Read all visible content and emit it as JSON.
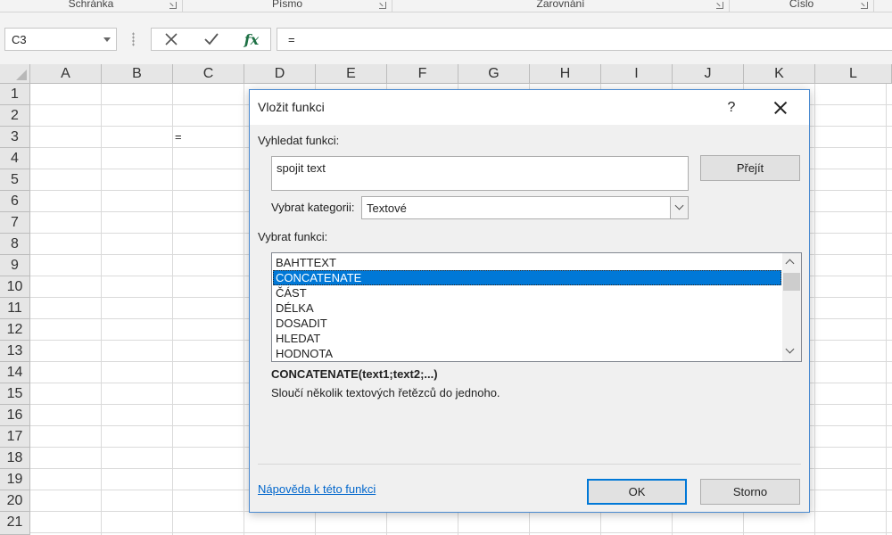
{
  "ribbon": {
    "groups": [
      {
        "label": "Schránka"
      },
      {
        "label": "Písmo"
      },
      {
        "label": "Zarovnání"
      },
      {
        "label": "Číslo"
      }
    ]
  },
  "formula_bar": {
    "name_box": "C3",
    "formula": "="
  },
  "grid": {
    "columns": [
      "A",
      "B",
      "C",
      "D",
      "E",
      "F",
      "G",
      "H",
      "I",
      "J",
      "K",
      "L"
    ],
    "rows": [
      "1",
      "2",
      "3",
      "4",
      "5",
      "6",
      "7",
      "8",
      "9",
      "10",
      "11",
      "12",
      "13",
      "14",
      "15",
      "16",
      "17",
      "18",
      "19",
      "20",
      "21"
    ],
    "cell_c3": "="
  },
  "dialog": {
    "title": "Vložit funkci",
    "help_symbol": "?",
    "search_label": "Vyhledat funkci:",
    "search_value": "spojit text",
    "go_button": "Přejít",
    "category_label": "Vybrat kategorii:",
    "category_value": "Textové",
    "function_label": "Vybrat funkci:",
    "functions": [
      "BAHTTEXT",
      "CONCATENATE",
      "ČÁST",
      "DÉLKA",
      "DOSADIT",
      "HLEDAT",
      "HODNOTA"
    ],
    "selected_function": "CONCATENATE",
    "signature": "CONCATENATE(text1;text2;...)",
    "description": "Sloučí několik textových řetězců do jednoho.",
    "help_link": "Nápověda k této funkci",
    "ok_button": "OK",
    "cancel_button": "Storno"
  },
  "colors": {
    "selection": "#0078d7",
    "dialog_border": "#4a8ad0",
    "fx_green": "#1e7145",
    "link": "#0066cc"
  }
}
